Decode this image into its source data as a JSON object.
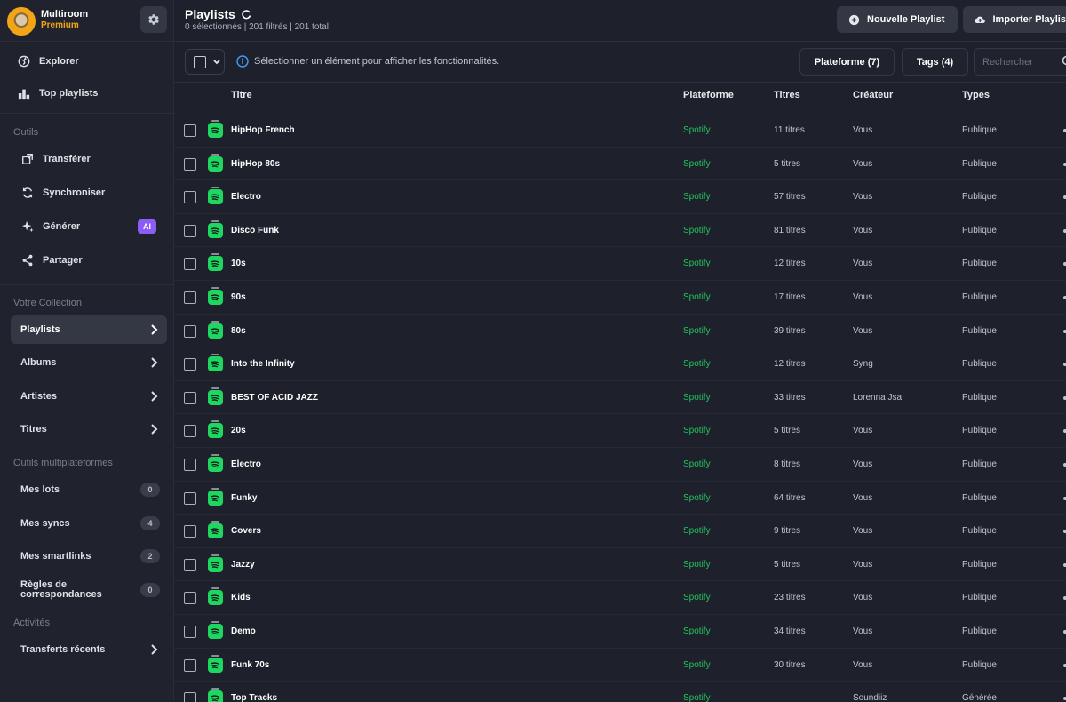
{
  "brand": {
    "name": "Multiroom",
    "tier": "Premium"
  },
  "sidebar": {
    "top_items": [
      {
        "label": "Explorer",
        "icon": "globe-icon"
      },
      {
        "label": "Top playlists",
        "icon": "bar-chart-icon"
      }
    ],
    "tools_label": "Outils",
    "tools": [
      {
        "label": "Transférer",
        "icon": "transfer-icon"
      },
      {
        "label": "Synchroniser",
        "icon": "sync-icon"
      },
      {
        "label": "Générer",
        "icon": "sparkle-icon",
        "badge": "AI"
      },
      {
        "label": "Partager",
        "icon": "share-icon"
      }
    ],
    "collection_label": "Votre Collection",
    "collection": [
      {
        "label": "Playlists",
        "active": true
      },
      {
        "label": "Albums"
      },
      {
        "label": "Artistes"
      },
      {
        "label": "Titres"
      }
    ],
    "multi_label": "Outils multiplateformes",
    "multi": [
      {
        "label": "Mes lots",
        "count": "0"
      },
      {
        "label": "Mes syncs",
        "count": "4"
      },
      {
        "label": "Mes smartlinks",
        "count": "2"
      },
      {
        "label_line1": "Règles de",
        "label_line2": "correspondances",
        "count": "0"
      }
    ],
    "activity_label": "Activités",
    "activity": [
      {
        "label": "Transferts récents"
      }
    ]
  },
  "header": {
    "title": "Playlists",
    "subtitle": "0 sélectionnés | 201 filtrés | 201 total",
    "new_playlist": "Nouvelle Playlist",
    "import_playlist": "Importer Playlis"
  },
  "toolbar": {
    "info": "Sélectionner un élément pour afficher les fonctionnalités.",
    "platform_filter": "Plateforme (7)",
    "tags_filter": "Tags (4)",
    "search_placeholder": "Rechercher"
  },
  "table": {
    "columns": [
      "Titre",
      "Plateforme",
      "Titres",
      "Créateur",
      "Types"
    ],
    "rows": [
      {
        "title": "HipHop French",
        "platform": "Spotify",
        "count": "11 titres",
        "creator": "Vous",
        "type": "Publique"
      },
      {
        "title": "HipHop 80s",
        "platform": "Spotify",
        "count": "5 titres",
        "creator": "Vous",
        "type": "Publique"
      },
      {
        "title": "Electro",
        "platform": "Spotify",
        "count": "57 titres",
        "creator": "Vous",
        "type": "Publique"
      },
      {
        "title": "Disco Funk",
        "platform": "Spotify",
        "count": "81 titres",
        "creator": "Vous",
        "type": "Publique"
      },
      {
        "title": "10s",
        "platform": "Spotify",
        "count": "12 titres",
        "creator": "Vous",
        "type": "Publique"
      },
      {
        "title": "90s",
        "platform": "Spotify",
        "count": "17 titres",
        "creator": "Vous",
        "type": "Publique"
      },
      {
        "title": "80s",
        "platform": "Spotify",
        "count": "39 titres",
        "creator": "Vous",
        "type": "Publique"
      },
      {
        "title": "Into the Infinity",
        "platform": "Spotify",
        "count": "12 titres",
        "creator": "Syng",
        "type": "Publique"
      },
      {
        "title": "BEST OF ACID JAZZ",
        "platform": "Spotify",
        "count": "33 titres",
        "creator": "Lorenna Jsa",
        "type": "Publique"
      },
      {
        "title": "20s",
        "platform": "Spotify",
        "count": "5 titres",
        "creator": "Vous",
        "type": "Publique"
      },
      {
        "title": "Electro",
        "platform": "Spotify",
        "count": "8 titres",
        "creator": "Vous",
        "type": "Publique"
      },
      {
        "title": "Funky",
        "platform": "Spotify",
        "count": "64 titres",
        "creator": "Vous",
        "type": "Publique"
      },
      {
        "title": "Covers",
        "platform": "Spotify",
        "count": "9 titres",
        "creator": "Vous",
        "type": "Publique"
      },
      {
        "title": "Jazzy",
        "platform": "Spotify",
        "count": "5 titres",
        "creator": "Vous",
        "type": "Publique"
      },
      {
        "title": "Kids",
        "platform": "Spotify",
        "count": "23 titres",
        "creator": "Vous",
        "type": "Publique"
      },
      {
        "title": "Demo",
        "platform": "Spotify",
        "count": "34 titres",
        "creator": "Vous",
        "type": "Publique"
      },
      {
        "title": "Funk 70s",
        "platform": "Spotify",
        "count": "30 titres",
        "creator": "Vous",
        "type": "Publique"
      },
      {
        "title": "Top Tracks",
        "platform": "Spotify",
        "count": "",
        "creator": "Soundiiz",
        "type": "Générée"
      }
    ]
  },
  "colors": {
    "accent_green": "#22c55e",
    "spotify_green": "#1ed760",
    "ai_purple": "#8b5cf6",
    "premium_gold": "#f2a516"
  }
}
